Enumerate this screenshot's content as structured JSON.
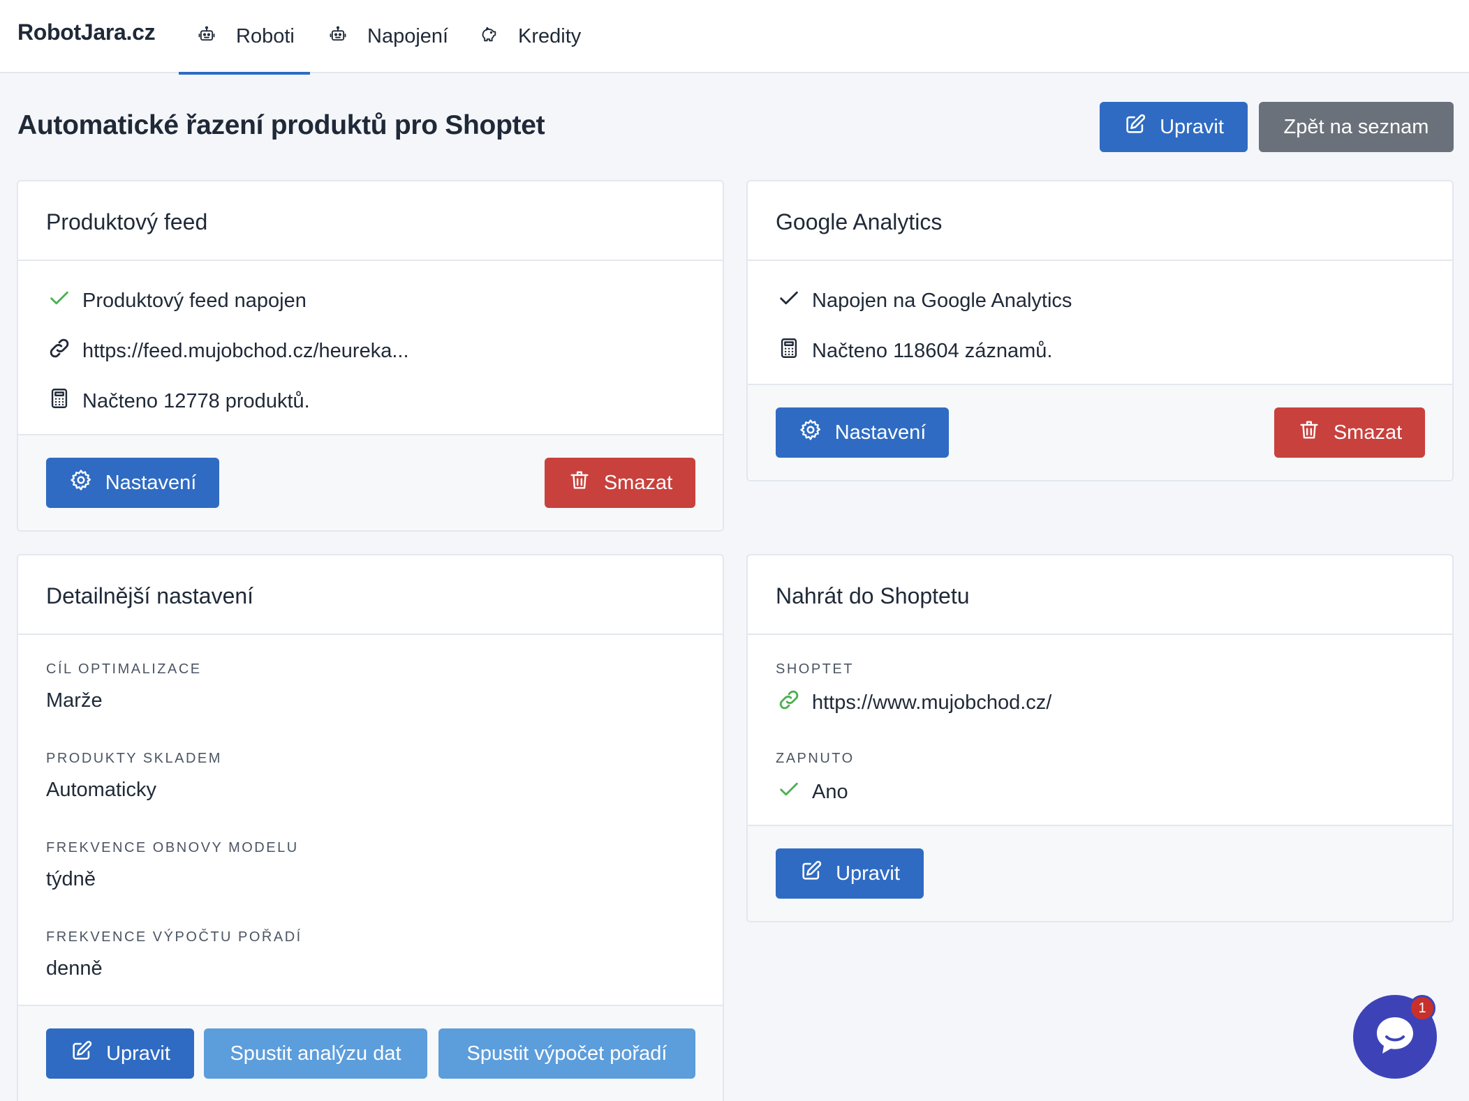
{
  "nav": {
    "brand": "RobotJara.cz",
    "tabs": [
      {
        "label": "Roboti",
        "icon": "robot-icon",
        "active": true
      },
      {
        "label": "Napojení",
        "icon": "robot-icon",
        "active": false
      },
      {
        "label": "Kredity",
        "icon": "piggy-bank-icon",
        "active": false
      }
    ]
  },
  "header": {
    "title": "Automatické řazení produktů pro Shoptet",
    "edit_label": "Upravit",
    "back_label": "Zpět na seznam"
  },
  "feed_card": {
    "title": "Produktový feed",
    "status": "Produktový feed napojen",
    "url": "https://feed.mujobchod.cz/heureka...",
    "count_text": "Načteno 12778 produktů.",
    "settings_label": "Nastavení",
    "delete_label": "Smazat"
  },
  "ga_card": {
    "title": "Google Analytics",
    "status": "Napojen na Google Analytics",
    "count_text": "Načteno 118604 záznamů.",
    "settings_label": "Nastavení",
    "delete_label": "Smazat"
  },
  "detail_card": {
    "title": "Detailnější nastavení",
    "fields": [
      {
        "label": "CÍL OPTIMALIZACE",
        "value": "Marže"
      },
      {
        "label": "PRODUKTY SKLADEM",
        "value": "Automaticky"
      },
      {
        "label": "FREKVENCE OBNOVY MODELU",
        "value": "týdně"
      },
      {
        "label": "FREKVENCE VÝPOČTU POŘADÍ",
        "value": "denně"
      }
    ],
    "edit_label": "Upravit",
    "analyze_label": "Spustit analýzu dat",
    "compute_label": "Spustit výpočet pořadí"
  },
  "shoptet_card": {
    "title": "Nahrát do Shoptetu",
    "shop_label": "SHOPTET",
    "shop_url": "https://www.mujobchod.cz/",
    "enabled_label": "ZAPNUTO",
    "enabled_value": "Ano",
    "edit_label": "Upravit"
  },
  "chat": {
    "badge": "1"
  },
  "colors": {
    "primary": "#2f6bc2",
    "danger": "#c8413d",
    "secondary": "#6b717a",
    "light_primary": "#5c9ddc",
    "success": "#4caf50",
    "chat": "#3d43b7"
  }
}
